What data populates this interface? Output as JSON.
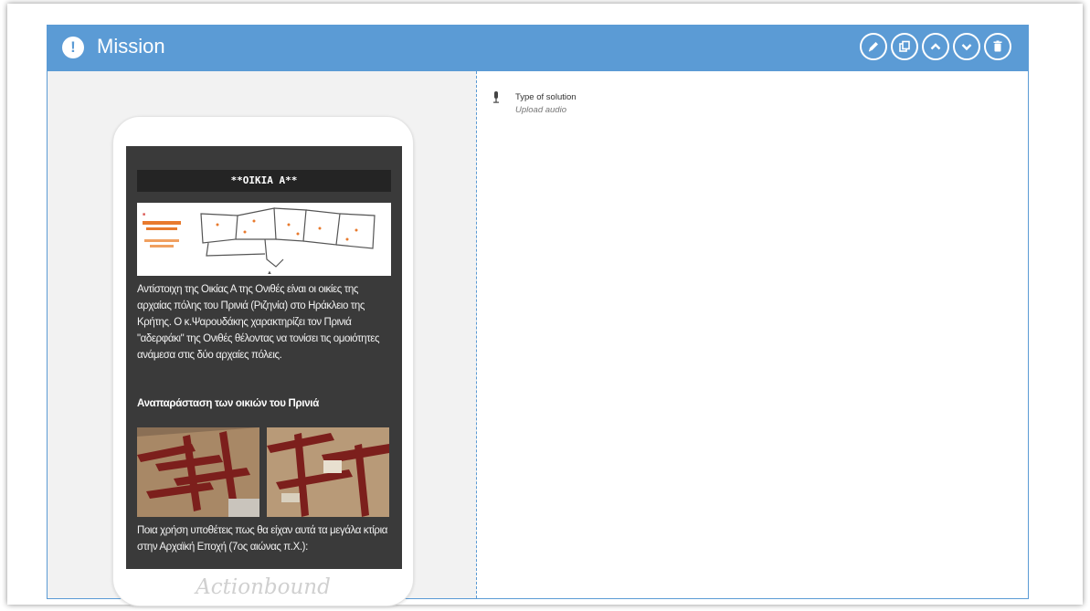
{
  "mission": {
    "title": "Mission",
    "header_color": "#5b9bd5",
    "tools": [
      {
        "name": "edit",
        "icon": "pencil-icon"
      },
      {
        "name": "duplicate",
        "icon": "copy-icon"
      },
      {
        "name": "move-up",
        "icon": "chevron-up-icon"
      },
      {
        "name": "move-down",
        "icon": "chevron-down-icon"
      },
      {
        "name": "delete",
        "icon": "trash-icon"
      }
    ]
  },
  "phone_preview": {
    "heading": "**ΟΙΚΙΑ Α**",
    "paragraph": "Αντίστοιχη της Οικίας Α της Ονιθές είναι οι οικίες της αρχαίας πόλης του Πρινιά (Ριζηνία) στο Ηράκλειο της Κρήτης. Ο κ.Ψαρουδάκης χαρακτηρίζει τον Πρινιά \"αδερφάκι\" της Ονιθές θέλοντας να τονίσει τις ομοιότητες ανάμεσα στις δύο αρχαίες πόλεις.",
    "subheading": "Αναπαράσταση των οικιών του Πρινιά",
    "question": "Ποια χρήση υποθέτεις πως θα είχαν αυτά τα μεγάλα κτίρια στην Αρχαϊκή Εποχή (7ος αιώνας π.Χ.):",
    "brand": "Actionbound"
  },
  "solution": {
    "icon": "microphone-icon",
    "type_label": "Type of solution",
    "value": "Upload audio"
  }
}
